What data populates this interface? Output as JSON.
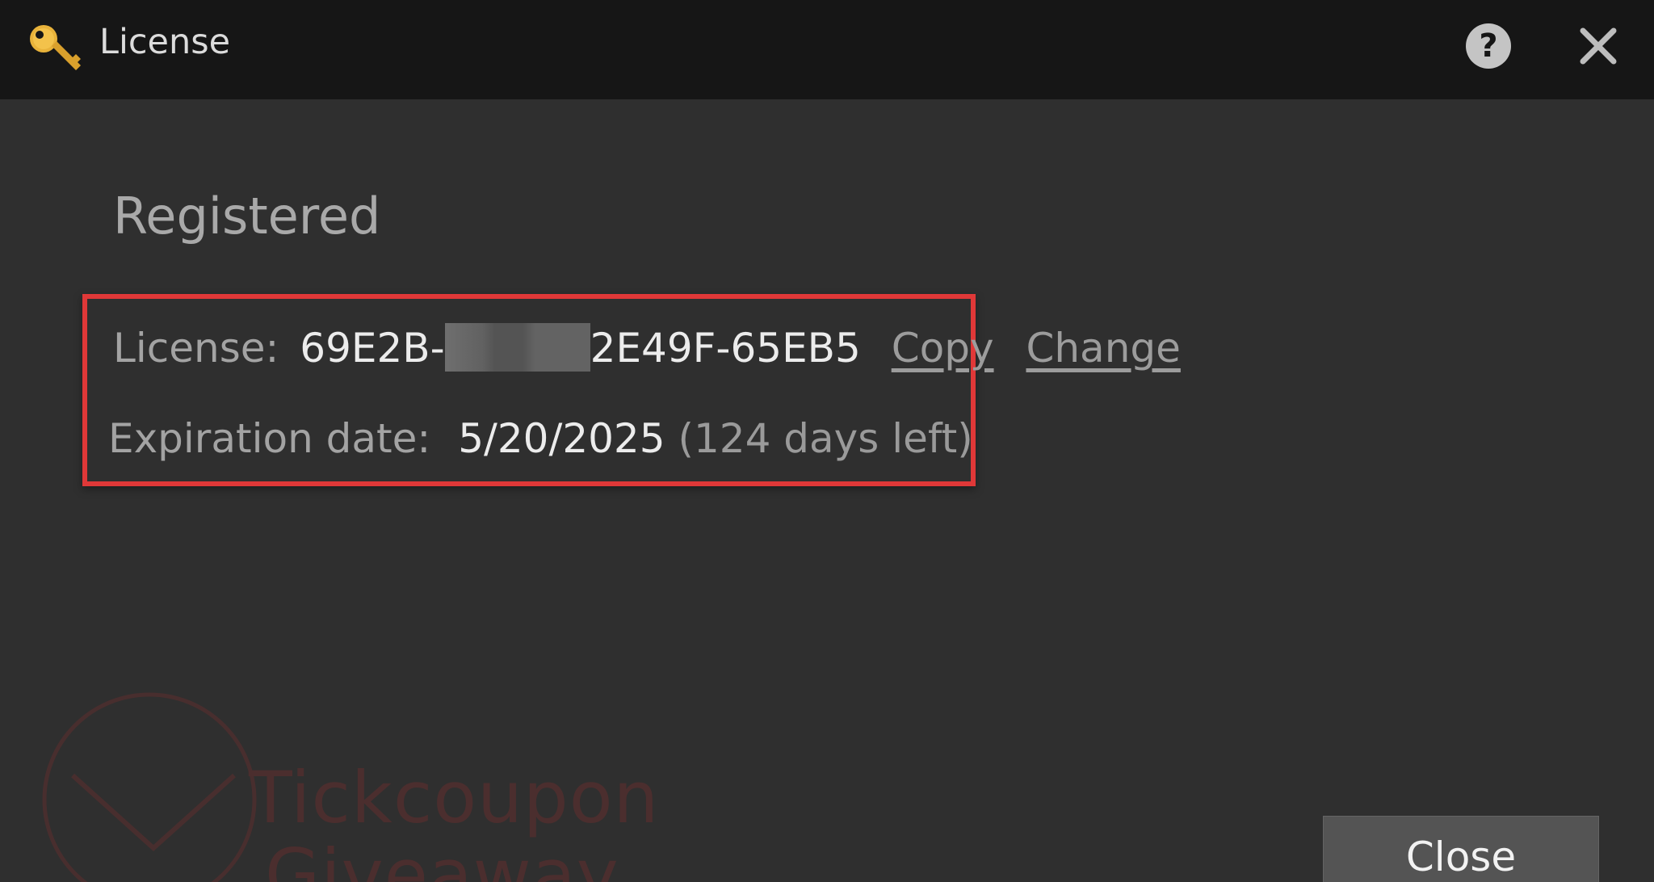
{
  "window": {
    "title": "License",
    "title_icon": "key-icon",
    "help_icon": "question-circle-icon",
    "close_icon": "close-x-icon"
  },
  "status": {
    "heading": "Registered"
  },
  "license": {
    "label": "License:",
    "key_prefix": "69E2B-",
    "key_suffix": "2E49F-65EB5",
    "key_redacted": true,
    "copy_label": "Copy",
    "change_label": "Change"
  },
  "expiration": {
    "label": "Expiration date:",
    "date": "5/20/2025",
    "days_left": "(124 days left)"
  },
  "watermark": {
    "line1": "Tickcoupon",
    "line2": "Giveaway",
    "color": "#4b2e2e"
  },
  "footer": {
    "close_label": "Close"
  },
  "colors": {
    "titlebar_bg": "#161616",
    "body_bg": "#2f2f2f",
    "highlight_border": "#e03838",
    "key_icon": "#e8b23a"
  }
}
